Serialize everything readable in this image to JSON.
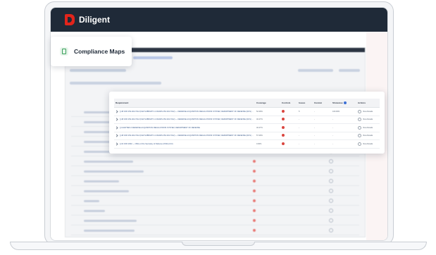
{
  "app": {
    "brand_name": "Diligent"
  },
  "module_card": {
    "title": "Compliance Maps",
    "icon": "clipboard-check-icon"
  },
  "requirements_table": {
    "columns": [
      "Requirement",
      "Coverage",
      "Controls",
      "Issues",
      "Custom",
      "Showcase",
      "Actions"
    ],
    "rows": [
      {
        "requirement": "§ 48 CFR 252.204-7012 (FAR SUBPART 4.4 DFARS 252.204-7012) — DEFENSE ACQUISITION REGULATIONS SYSTEM, DEPARTMENT OF DEFENSE (DCS) ...",
        "coverage": "52.39%",
        "controls_flag": true,
        "issues": "5",
        "custom": "-",
        "showcase": "100.00%",
        "action": "View Details"
      },
      {
        "requirement": "§ 48 CFR 252.204-7012 (FAR SUBPART 4.4 DFARS 252.204-7012) — DEFENSE ACQUISITION REGULATIONS SYSTEM, DEPARTMENT OF DEFENSE (DCS) ...",
        "coverage": "46.47%",
        "controls_flag": true,
        "issues": "-",
        "custom": "-",
        "showcase": "-",
        "action": "View Details"
      },
      {
        "requirement": "§ CHAPTER 2 DEFENSE ACQUISITION REGULATIONS SYSTEM, DEPARTMENT OF DEFENSE",
        "coverage": "46.47%",
        "controls_flag": true,
        "issues": "-",
        "custom": "-",
        "showcase": "-",
        "action": "View Details"
      },
      {
        "requirement": "§ 48 CFR 252.204-7012 (FAR SUBPART 4.4 DFARS 252.204-7012) — DEFENSE ACQUISITION REGULATIONS SYSTEM, DEPARTMENT OF DEFENSE (DCS) ...",
        "coverage": "57.39%",
        "controls_flag": true,
        "issues": "-",
        "custom": "-",
        "showcase": "-",
        "action": "View Details"
      },
      {
        "requirement": "§ 32 CFR 2002 — Office of the Secretary of Defense (OSD) (CUI)",
        "coverage": "0.00%",
        "controls_flag": true,
        "issues": "-",
        "custom": "-",
        "showcase": "-",
        "action": "View Details"
      }
    ]
  },
  "colors": {
    "header_bg": "#1f2a38",
    "brand_red": "#e2241b",
    "status_red": "#d9453f",
    "link_blue": "#3a5a8c"
  }
}
